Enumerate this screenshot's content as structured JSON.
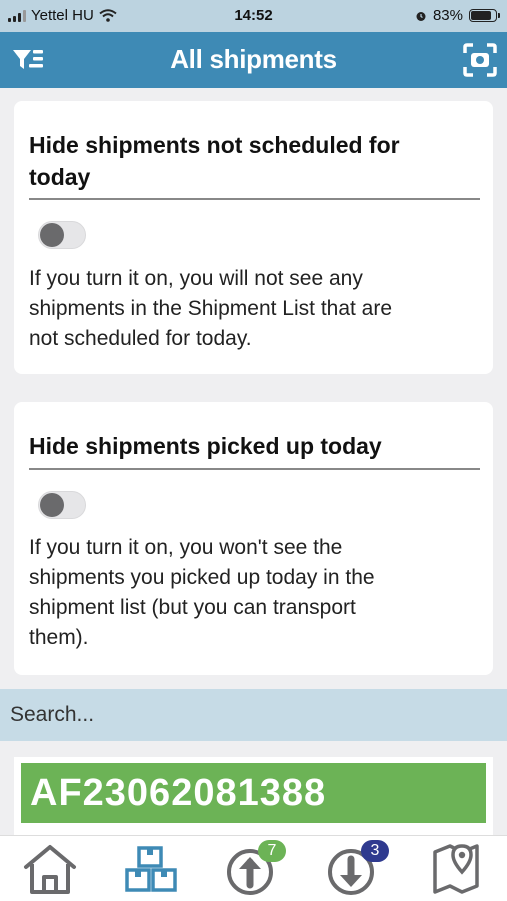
{
  "status_bar": {
    "carrier": "Yettel HU",
    "time": "14:52",
    "battery_percent_label": "83%",
    "battery_level": 0.83
  },
  "header": {
    "title": "All shipments",
    "left_icon": "filter-list-icon",
    "right_icon": "scan-icon"
  },
  "settings": [
    {
      "title_line1": "Hide shipments not scheduled for",
      "title_line2": "today",
      "toggle_on": false,
      "desc_line1": "If you turn it on, you will not see any",
      "desc_line2": "shipments in the Shipment List that are",
      "desc_line3": "not scheduled for today."
    },
    {
      "title_line1": "Hide shipments picked up today",
      "toggle_on": false,
      "desc_line1": "If you turn it on, you won't see the",
      "desc_line2": "shipments you picked up today in the",
      "desc_line3": "shipment list (but you can transport",
      "desc_line4": "them)."
    }
  ],
  "search": {
    "placeholder": "Search..."
  },
  "results": [
    {
      "code": "AF23062081388"
    }
  ],
  "bottom_nav": {
    "items": [
      {
        "icon": "home-icon"
      },
      {
        "icon": "packages-icon"
      },
      {
        "icon": "upload-icon",
        "badge": "7"
      },
      {
        "icon": "download-icon",
        "badge": "3"
      },
      {
        "icon": "map-icon"
      }
    ]
  },
  "colors": {
    "header": "#3e8ab5",
    "status_bar": "#bcd3e0",
    "search_bar": "#c6dbe6",
    "result_green": "#6cb356",
    "badge_green": "#6cb356",
    "badge_navy": "#2f3a8f",
    "nav_icon_gray": "#6a6a6c",
    "nav_icon_active": "#3e8ab5"
  }
}
